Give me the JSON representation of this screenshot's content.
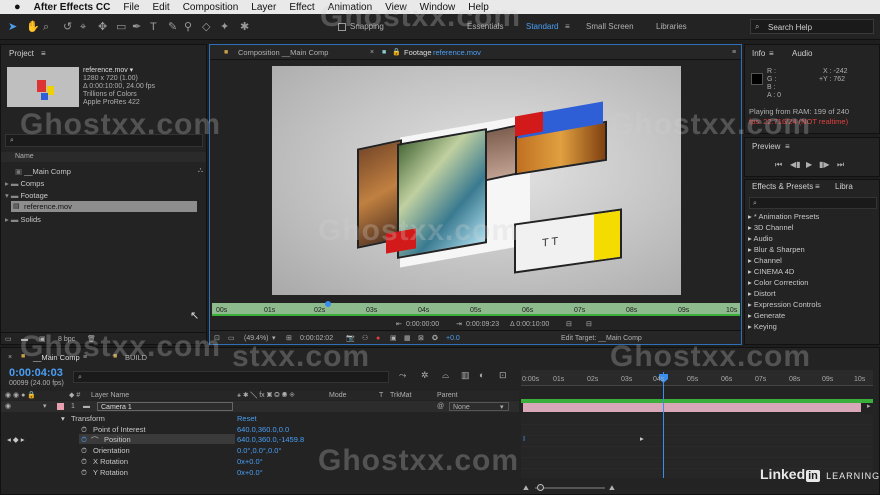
{
  "menubar": {
    "app": "After Effects CC",
    "items": [
      "File",
      "Edit",
      "Composition",
      "Layer",
      "Effect",
      "Animation",
      "View",
      "Window",
      "Help"
    ]
  },
  "toolbar": {
    "snapping": "Snapping",
    "workspaces": [
      "Essentials",
      "Standard",
      "Small Screen",
      "Libraries"
    ],
    "search_placeholder": "Search Help"
  },
  "project": {
    "title": "Project",
    "footage_name": "reference.mov ▾",
    "footage_info": [
      "1280 x 720 (1.00)",
      "Δ 0:00:10:00, 24.00 fps",
      "Trillions of Colors",
      "Apple ProRes 422"
    ],
    "col_name": "Name",
    "items": [
      "__Main Comp",
      "Comps",
      "Footage",
      "reference.mov",
      "Solids"
    ],
    "bpc": "8 bpc"
  },
  "viewer": {
    "tab_comp": "Composition __Main Comp",
    "tab_footage_prefix": "Footage",
    "tab_footage_name": "reference.mov",
    "card_text": "T T",
    "ruler": [
      "00s",
      "01s",
      "02s",
      "03s",
      "04s",
      "05s",
      "06s",
      "07s",
      "08s",
      "09s",
      "10s"
    ],
    "time_in": "0:00:00:00",
    "time_out": "0:00:09:23",
    "duration": "Δ 0:00:10:00",
    "zoom": "(49.4%)",
    "current": "0:00:02:02",
    "exposure": "+0.0",
    "edit_target": "Edit Target: __Main Comp"
  },
  "info": {
    "tab": "Info",
    "tab2": "Audio",
    "rgb": [
      "R :",
      "G :",
      "B :",
      "A : 0"
    ],
    "x": "X : -242",
    "y": "Y : 762",
    "playing": "Playing from RAM: 199 of 240",
    "fps": "fps: 22.716/24 (NOT realtime)"
  },
  "preview": {
    "title": "Preview"
  },
  "effects": {
    "title": "Effects & Presets",
    "tab2": "Libra",
    "items": [
      "* Animation Presets",
      "3D Channel",
      "Audio",
      "Blur & Sharpen",
      "Channel",
      "CINEMA 4D",
      "Color Correction",
      "Distort",
      "Expression Controls",
      "Generate",
      "Keying"
    ]
  },
  "timeline": {
    "tab1": "__Main Comp",
    "tab2": "BUILD",
    "timecode": "0:00:04:03",
    "frames": "00099 (24.00 fps)",
    "cols": {
      "layer_name": "Layer Name",
      "mode": "Mode",
      "t": "T",
      "trkmat": "TrkMat",
      "parent": "Parent"
    },
    "layer_num": "1",
    "layer_name": "Camera 1",
    "parent_val": "None",
    "transform": "Transform",
    "reset": "Reset",
    "props": [
      {
        "name": "Point of Interest",
        "value": "640.0,360.0,0.0"
      },
      {
        "name": "Position",
        "value": "640.0,360.0,-1459.8"
      },
      {
        "name": "Orientation",
        "value": "0.0°,0.0°,0.0°"
      },
      {
        "name": "X Rotation",
        "value": "0x+0.0°"
      },
      {
        "name": "Y Rotation",
        "value": "0x+0.0°"
      }
    ],
    "ruler": [
      "0:00s",
      "01s",
      "02s",
      "03s",
      "04s",
      "05s",
      "06s",
      "07s",
      "08s",
      "09s",
      "10s"
    ]
  },
  "watermarks": [
    "Ghostxx.com",
    "Ghostxx.com",
    "Ghostxx.com",
    "Ghostxx.com",
    "Ghostxx.com",
    "Ghostxx.com",
    "stxx.com",
    "Ghostxx.com"
  ],
  "linkedin": {
    "name": "Linked",
    "in": "in",
    "learning": "LEARNING"
  }
}
